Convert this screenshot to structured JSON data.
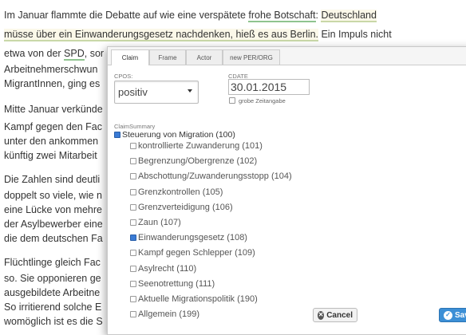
{
  "article": {
    "l1a": "Im Januar flammte die Debatte auf wie eine verspätete ",
    "l1b": "frohe Botschaft",
    "l1c": ": ",
    "l1d": "Deutschland",
    "l2a": "müsse über ein Einwanderungsgesetz nachdenken, hieß es aus Berlin.",
    "l2b": " Ein Impuls nicht",
    "l3a": "etwa von der ",
    "l3b": "SPD",
    "l3c": ", sor",
    "l4": "Arbeitnehmerschwun",
    "l5": "MigrantInnen, ging es",
    "l6": "Mitte Januar verkünde",
    "l7": "Kampf gegen den Fac",
    "l8": "unter den ankommen",
    "l9": "künftig zwei Mitarbeit",
    "l10": "Die Zahlen sind deutli",
    "l11": "doppelt so viele, wie n",
    "l12": "eine Lücke von mehre",
    "l13": "der Asylbewerber eine",
    "l14": "die dem deutschen Fa",
    "l15": "Flüchtlinge gleich Fac",
    "l16": "so. Sie opponieren ge",
    "l17": "ausgebildete Arbeitne",
    "l18": "So irritierend solche E",
    "l19": "womöglich ist es die S"
  },
  "modal": {
    "tabs": [
      "Claim",
      "Frame",
      "Actor",
      "new PER/ORG"
    ],
    "pos_label": "CPOS:",
    "pos_value": "positiv",
    "date_label": "CDATE",
    "date_value": "30.01.2015",
    "grobe_label": "grobe Zeitangabe",
    "summary_label": "ClaimSummary",
    "root": "Steuerung von Migration (100)",
    "items": [
      {
        "label": "kontrollierte Zuwanderung (101)",
        "checked": false
      },
      {
        "label": "Begrenzung/Obergrenze (102)",
        "checked": false
      },
      {
        "label": "Abschottung/Zuwanderungsstopp (104)",
        "checked": false
      },
      {
        "label": "Grenzkontrollen (105)",
        "checked": false
      },
      {
        "label": "Grenzverteidigung (106)",
        "checked": false
      },
      {
        "label": "Zaun (107)",
        "checked": false
      },
      {
        "label": "Einwanderungsgesetz (108)",
        "checked": true
      },
      {
        "label": "Kampf gegen Schlepper (109)",
        "checked": false
      },
      {
        "label": "Asylrecht (110)",
        "checked": false
      },
      {
        "label": "Seenotrettung (111)",
        "checked": false
      },
      {
        "label": "Aktuelle Migrationspolitik (190)",
        "checked": false
      },
      {
        "label": "Allgemein (199)",
        "checked": false
      }
    ],
    "cancel_label": "Cancel",
    "save_label": "Save",
    "colors": {
      "accent": "#3c8fd6",
      "highlight_bg": "#fbf8e9",
      "underline": "#8fc48f"
    }
  },
  "icons": {
    "cancel": "x-circle-icon",
    "save": "check-circle-icon",
    "select": "chevron-down-icon"
  }
}
